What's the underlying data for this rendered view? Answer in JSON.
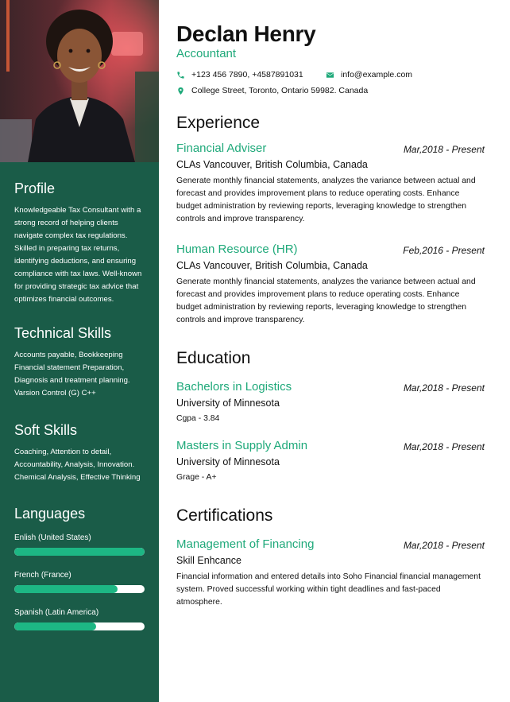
{
  "name": "Declan Henry",
  "role": "Accountant",
  "contact": {
    "phone": "+123 456 7890, +4587891031",
    "email": "info@example.com",
    "address": "College Street, Toronto, Ontario 59982. Canada"
  },
  "colors": {
    "sidebar": "#1a5c48",
    "accent": "#1fa97a",
    "bar": "#1db784"
  },
  "sidebar": {
    "profile": {
      "heading": "Profile",
      "lines": [
        "Knowledgeable Tax Consultant with a",
        "strong record of helping clients",
        "navigate complex tax regulations.",
        "Skilled in preparing tax returns,",
        "identifying deductions, and ensuring",
        "compliance with tax laws. Well-known",
        "for providing strategic tax advice that",
        "optimizes financial outcomes."
      ]
    },
    "technical": {
      "heading": "Technical Skills",
      "lines": [
        "Accounts payable, Bookkeeping",
        "Financial statement Preparation,",
        "Diagnosis and treatment planning.",
        "Varsion Control (G) C++"
      ]
    },
    "soft": {
      "heading": "Soft Skills",
      "lines": [
        "Coaching, Attention to detail,",
        "Accountability, Analysis, Innovation.",
        "Chemical Analysis, Effective Thinking"
      ]
    },
    "languages": {
      "heading": "Languages",
      "items": [
        {
          "label": "Enlish (United States)",
          "level": 1.0
        },
        {
          "label": "French (France)",
          "level": 0.79
        },
        {
          "label": "Spanish (Latin America)",
          "level": 0.63
        }
      ]
    }
  },
  "experience": {
    "heading": "Experience",
    "items": [
      {
        "title": "Financial Adviser",
        "date": "Mar,2018 - Present",
        "org": "CLAs Vancouver, British Columbia, Canada",
        "lines": [
          "Generate monthly financial statements, analyzes the variance between actual and",
          "forecast and provides improvement plans to reduce operating costs. Enhance",
          "budget administration by reviewing reports, leveraging knowledge to strengthen",
          "controls and improve transparency."
        ]
      },
      {
        "title": "Human Resource (HR)",
        "date": "Feb,2016 - Present",
        "org": "CLAs Vancouver, British Columbia, Canada",
        "lines": [
          "Generate monthly financial statements, analyzes the variance between actual and",
          "forecast and provides improvement plans to reduce operating costs. Enhance",
          "budget administration by reviewing reports, leveraging knowledge to strengthen",
          "controls and improve transparency."
        ]
      }
    ]
  },
  "education": {
    "heading": "Education",
    "items": [
      {
        "title": "Bachelors in Logistics",
        "date": "Mar,2018 - Present",
        "org": "University of Minnesota",
        "note": "Cgpa - 3.84"
      },
      {
        "title": "Masters in Supply Admin",
        "date": "Mar,2018 - Present",
        "org": "University of Minnesota",
        "note": "Grage - A+"
      }
    ]
  },
  "certifications": {
    "heading": "Certifications",
    "items": [
      {
        "title": "Management of Financing",
        "date": "Mar,2018 - Present",
        "org": "Skill Enhcance",
        "lines": [
          "Financial information and entered details into Soho Financial financial management",
          "system. Proved successful working within tight deadlines and fast-paced",
          "atmosphere."
        ]
      }
    ]
  }
}
